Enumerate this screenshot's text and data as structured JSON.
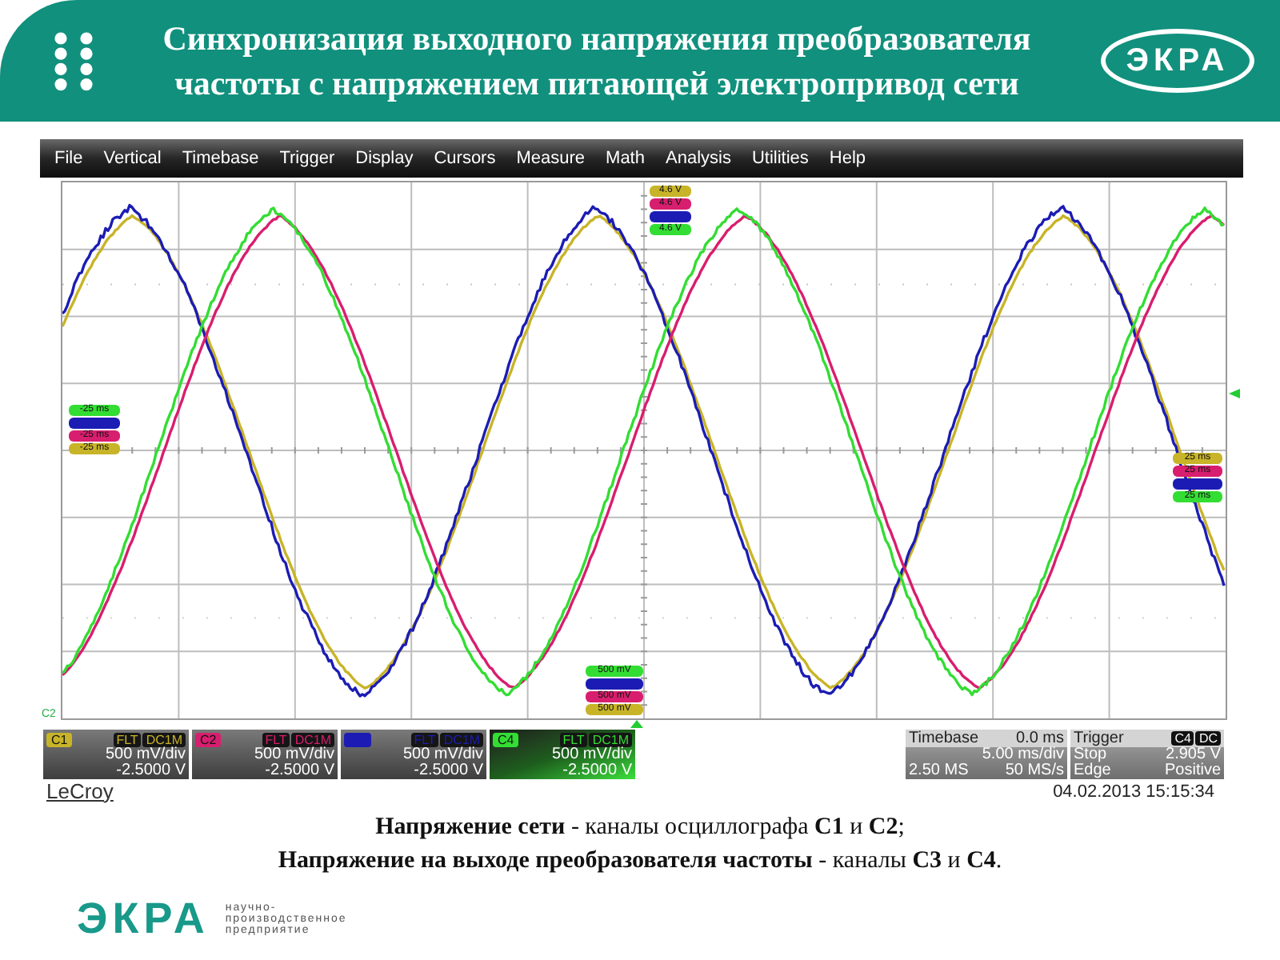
{
  "header": {
    "title_lines": [
      "Синхронизация выходного напряжения преобразователя",
      "частоты с напряжением питающей электропривод сети"
    ],
    "logo": "ЭКРА"
  },
  "scope": {
    "menu": [
      "File",
      "Vertical",
      "Timebase",
      "Trigger",
      "Display",
      "Cursors",
      "Measure",
      "Math",
      "Analysis",
      "Utilities",
      "Help"
    ],
    "voltage_markers": [
      {
        "color": "#c8b428",
        "text": "4.6 V"
      },
      {
        "color": "#d81e6e",
        "text": "4.6 V"
      },
      {
        "color": "#1c1cb4"
      },
      {
        "color": "#33dd33",
        "text": "4.6 V"
      }
    ],
    "left_time_markers": [
      {
        "color": "#33dd33",
        "text": "-25 ms"
      },
      {
        "color": "#1c1cb4"
      },
      {
        "color": "#d81e6e",
        "text": "-25 ms"
      },
      {
        "color": "#c8b428",
        "text": "-25 ms"
      }
    ],
    "right_time_markers": [
      {
        "color": "#c8b428",
        "text": "25 ms"
      },
      {
        "color": "#d81e6e",
        "text": "25 ms"
      },
      {
        "color": "#1c1cb4"
      },
      {
        "color": "#33dd33",
        "text": "25 ms"
      }
    ],
    "scale_markers": [
      {
        "color": "#33dd33",
        "text": "500 mV"
      },
      {
        "color": "#1c1cb4"
      },
      {
        "color": "#d81e6e",
        "text": "500 mV"
      },
      {
        "color": "#c8b428",
        "text": "500 mV"
      }
    ],
    "ground_marker": "C2",
    "channels": [
      {
        "label": "C1",
        "color": "#c8b428",
        "selected": false,
        "flags": [
          "FLT",
          "DC1M"
        ],
        "scale": "500 mV/div",
        "offset": "-2.5000 V"
      },
      {
        "label": "C2",
        "color": "#d81e6e",
        "selected": false,
        "flags": [
          "FLT",
          "DC1M"
        ],
        "scale": "500 mV/div",
        "offset": "-2.5000 V"
      },
      {
        "color": "#1c1cb4",
        "selected": false,
        "flags": [
          "FLT",
          "DC1M"
        ],
        "scale": "500 mV/div",
        "offset": "-2.5000 V"
      },
      {
        "label": "C4",
        "color": "#33dd33",
        "selected": true,
        "flags": [
          "FLT",
          "DC1M"
        ],
        "scale": "500 mV/div",
        "offset": "-2.5000 V"
      }
    ],
    "timebase": {
      "title": "Timebase",
      "delay": "0.0 ms",
      "scale": "5.00 ms/div",
      "samples": "2.50 MS",
      "rate": "50 MS/s"
    },
    "trigger": {
      "title": "Trigger",
      "source": "C4",
      "coupling": "DC",
      "state": "Stop",
      "voltage": "2.905 V",
      "slope_label": "Edge",
      "slope": "Positive"
    },
    "brand": "LeCroy",
    "timestamp": "04.02.2013 15:15:34"
  },
  "caption": [
    "**Напряжение сети** - каналы осциллографа **C1** и **C2**;",
    "**Напряжение на выходе преобразователя частоты** - каналы **C3** и **C4**."
  ],
  "footer": {
    "logo": "ЭКРА",
    "tagline": [
      "научно-",
      "производственное",
      "предприятие"
    ]
  }
}
